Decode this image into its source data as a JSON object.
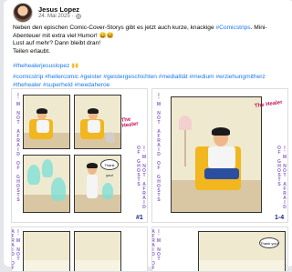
{
  "post": {
    "author": "Jesus Lopez",
    "date": "24. Mai 2025",
    "separator": "·",
    "line1_a": "Neben den epischen Comic-Cover-Storys gibt es jetzt auch kurze, knackige ",
    "line1_tag": "#Comicstrips",
    "line1_b": ". Mini-Abenteuer mit extra viel Humor! 😄😆",
    "line2": "Lust auf mehr? Dann bleibt dran!",
    "line3": "Teilen erlaubt.",
    "tag_main": "#thehealerjesuslopez 🙌",
    "tags_line": "#comicstrip #heilercomic #geister #geistergeschichten #medialität #medium #erziehungmitherz #thehealer #superheld #needaheroe"
  },
  "gallery": {
    "strip_text": "I'M NOT AFRAID OF GHOSTS",
    "logo_text": "The Healer",
    "bubble_text": "Thank you!",
    "panel_numbers": [
      "#1",
      "1-4"
    ]
  }
}
